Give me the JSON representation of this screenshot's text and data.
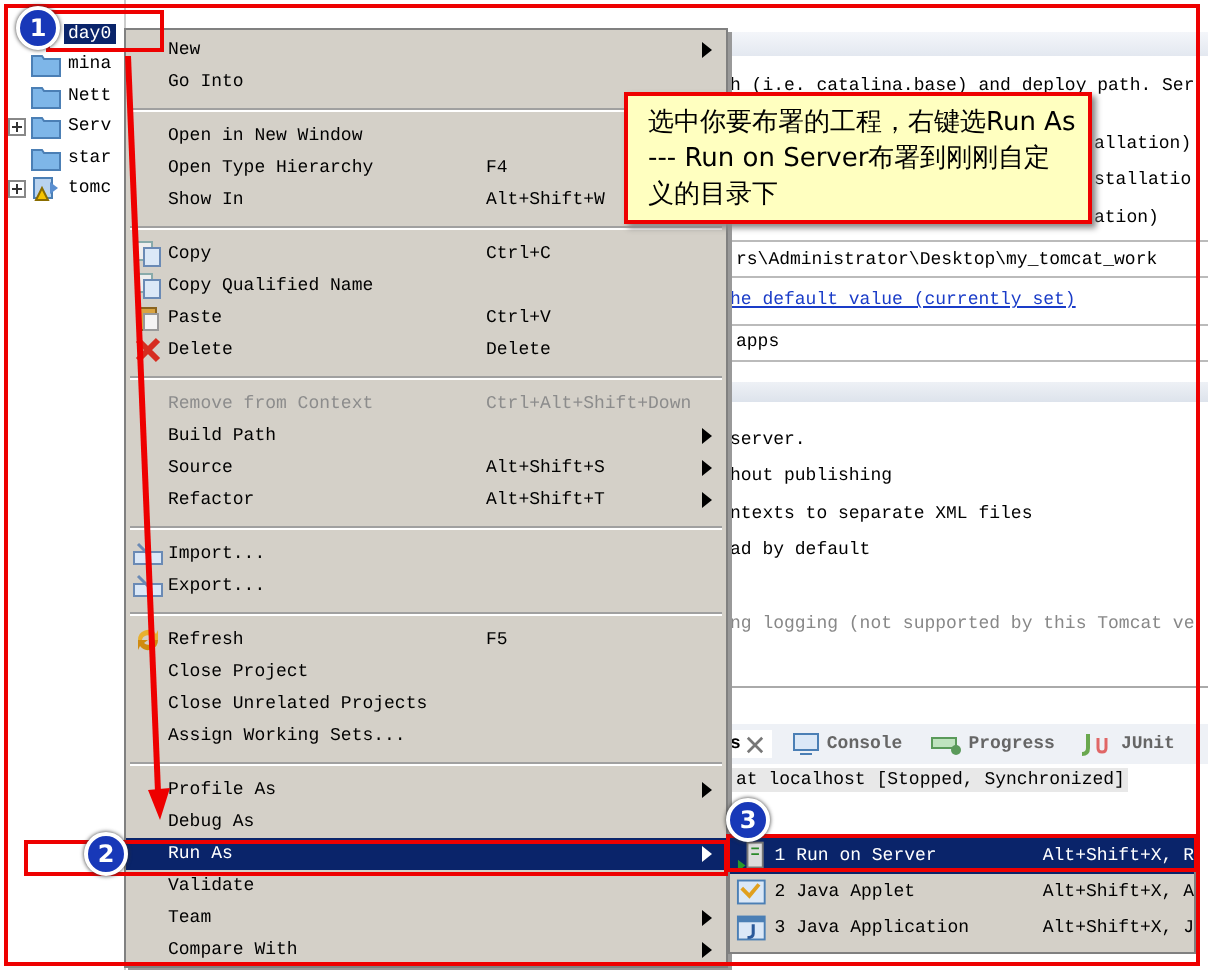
{
  "tree": {
    "items": [
      {
        "label": "day0",
        "selected": true,
        "collapsed": false
      },
      {
        "label": "mina",
        "selected": false,
        "collapsed": false
      },
      {
        "label": "Nett",
        "selected": false,
        "collapsed": false
      },
      {
        "label": "Serv",
        "selected": false,
        "collapsed": true
      },
      {
        "label": "star",
        "selected": false,
        "collapsed": false
      },
      {
        "label": "tomc",
        "selected": false,
        "collapsed": true
      }
    ]
  },
  "editor": {
    "lines": [
      {
        "kind": "text",
        "text": "h (i.e. catalina.base) and deploy path. Ser"
      },
      {
        "kind": "tail",
        "text": "allation)"
      },
      {
        "kind": "tail",
        "text": "stallatio"
      },
      {
        "kind": "tail",
        "text": "ation)"
      },
      {
        "kind": "field",
        "text": "rs\\Administrator\\Desktop\\my_tomcat_work"
      },
      {
        "kind": "link",
        "text": "he default value (currently set)"
      },
      {
        "kind": "field",
        "text": "apps"
      },
      {
        "kind": "section"
      },
      {
        "kind": "text",
        "text": "server."
      },
      {
        "kind": "text",
        "text": "hout publishing"
      },
      {
        "kind": "text",
        "text": "ntexts to separate XML files"
      },
      {
        "kind": "text",
        "text": "ad by default"
      },
      {
        "kind": "muted",
        "text": "ng logging (not supported by this Tomcat ve"
      }
    ]
  },
  "bottom_panel": {
    "tabs": [
      {
        "label": "s",
        "selected": true
      },
      {
        "label": "Console",
        "selected": false
      },
      {
        "label": "Progress",
        "selected": false
      },
      {
        "label": "JUnit",
        "selected": false
      }
    ],
    "server_row": "at localhost  [Stopped, Synchronized]"
  },
  "context_menu": {
    "items": [
      {
        "kind": "item",
        "label": "New",
        "submenu": true,
        "disabled": false,
        "selected": false
      },
      {
        "kind": "item",
        "label": "Go Into",
        "disabled": false,
        "selected": false
      },
      {
        "kind": "separator"
      },
      {
        "kind": "item",
        "label": "Open in New Window",
        "disabled": false,
        "selected": false
      },
      {
        "kind": "item",
        "label": "Open Type Hierarchy",
        "shortcut": "F4",
        "disabled": false,
        "selected": false
      },
      {
        "kind": "item",
        "label": "Show In",
        "shortcut": "Alt+Shift+W",
        "disabled": false,
        "selected": false
      },
      {
        "kind": "separator"
      },
      {
        "kind": "item",
        "label": "Copy",
        "shortcut": "Ctrl+C",
        "disabled": false,
        "selected": false
      },
      {
        "kind": "item",
        "label": "Copy Qualified Name",
        "disabled": false,
        "selected": false
      },
      {
        "kind": "item",
        "label": "Paste",
        "shortcut": "Ctrl+V",
        "disabled": false,
        "selected": false
      },
      {
        "kind": "item",
        "label": "Delete",
        "shortcut": "Delete",
        "disabled": false,
        "selected": false
      },
      {
        "kind": "separator"
      },
      {
        "kind": "item",
        "label": "Remove from Context",
        "shortcut": "Ctrl+Alt+Shift+Down",
        "disabled": true,
        "selected": false
      },
      {
        "kind": "item",
        "label": "Build Path",
        "submenu": true,
        "disabled": false,
        "selected": false
      },
      {
        "kind": "item",
        "label": "Source",
        "shortcut": "Alt+Shift+S",
        "submenu": true,
        "disabled": false,
        "selected": false
      },
      {
        "kind": "item",
        "label": "Refactor",
        "shortcut": "Alt+Shift+T",
        "submenu": true,
        "disabled": false,
        "selected": false
      },
      {
        "kind": "separator"
      },
      {
        "kind": "item",
        "label": "Import...",
        "disabled": false,
        "selected": false
      },
      {
        "kind": "item",
        "label": "Export...",
        "disabled": false,
        "selected": false
      },
      {
        "kind": "separator"
      },
      {
        "kind": "item",
        "label": "Refresh",
        "shortcut": "F5",
        "disabled": false,
        "selected": false
      },
      {
        "kind": "item",
        "label": "Close Project",
        "disabled": false,
        "selected": false
      },
      {
        "kind": "item",
        "label": "Close Unrelated Projects",
        "disabled": false,
        "selected": false
      },
      {
        "kind": "item",
        "label": "Assign Working Sets...",
        "disabled": false,
        "selected": false
      },
      {
        "kind": "separator"
      },
      {
        "kind": "item",
        "label": "Profile As",
        "submenu": true,
        "disabled": false,
        "selected": false
      },
      {
        "kind": "item",
        "label": "Debug As",
        "disabled": false,
        "selected": false
      },
      {
        "kind": "item",
        "label": "Run As",
        "submenu": true,
        "disabled": false,
        "selected": true
      },
      {
        "kind": "item",
        "label": "Validate",
        "disabled": false,
        "selected": false
      },
      {
        "kind": "item",
        "label": "Team",
        "submenu": true,
        "disabled": false,
        "selected": false
      },
      {
        "kind": "item",
        "label": "Compare With",
        "submenu": true,
        "disabled": false,
        "selected": false
      }
    ]
  },
  "submenu": {
    "items": [
      {
        "label": "1 Run on Server",
        "shortcut": "Alt+Shift+X, R",
        "selected": true
      },
      {
        "label": "2 Java Applet",
        "shortcut": "Alt+Shift+X, A",
        "selected": false
      },
      {
        "label": "3 Java Application",
        "shortcut": "Alt+Shift+X, J",
        "selected": false
      }
    ]
  },
  "callout": {
    "text": "选中你要布署的工程，右键选Run As --- Run on Server布署到刚刚自定义的目录下"
  },
  "badges": [
    "1",
    "2",
    "3"
  ]
}
